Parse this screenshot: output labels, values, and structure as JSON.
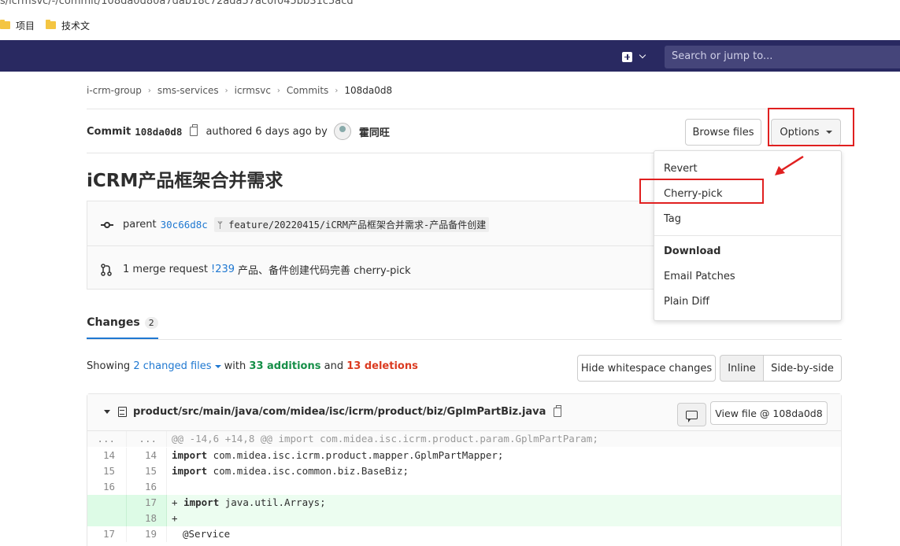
{
  "browser": {
    "url": "s/icrmsvc/-/commit/108da0d80a7dab18c72ada57ac0f045bb31c5acd",
    "bookmarks": [
      {
        "label": "项目",
        "icon": "folder-icon"
      },
      {
        "label": "技术文",
        "icon": "folder-icon"
      }
    ]
  },
  "navbar": {
    "search_placeholder": "Search or jump to...",
    "new_icon": "plus-square-icon",
    "bg_color": "#292961"
  },
  "breadcrumb": [
    "i-crm-group",
    "sms-services",
    "icrmsvc",
    "Commits",
    "108da0d8"
  ],
  "commit": {
    "label": "Commit",
    "sha": "108da0d8",
    "authored": "authored 6 days ago by",
    "author": "霍同旺",
    "browse_files": "Browse files",
    "options": "Options",
    "title": "iCRM产品框架合并需求",
    "parent_label": "parent",
    "parent_sha": "30c66d8c",
    "branch": "feature/20220415/iCRM产品框架合并需求-产品备件创建",
    "mr_prefix": "1 merge request",
    "mr_ref": "!239",
    "mr_title": "产品、备件创建代码完善 cherry-pick"
  },
  "options_menu": {
    "items": [
      "Revert",
      "Cherry-pick",
      "Tag"
    ],
    "download_header": "Download",
    "download_items": [
      "Email Patches",
      "Plain Diff"
    ]
  },
  "changes": {
    "tab_label": "Changes",
    "count": "2",
    "showing": "Showing",
    "files_link": "2 changed files",
    "with": "with",
    "additions": "33 additions",
    "and": "and",
    "deletions": "13 deletions",
    "hide_whitespace": "Hide whitespace changes",
    "inline": "Inline",
    "side_by_side": "Side-by-side"
  },
  "file": {
    "path": "product/src/main/java/com/midea/isc/icrm/product/biz/GplmPartBiz.java",
    "view_file": "View file @ 108da0d8"
  },
  "diff_lines": [
    {
      "old": "...",
      "new": "...",
      "sign": "",
      "code": "@@ -14,6 +14,8 @@ import com.midea.isc.icrm.product.param.GplmPartParam;",
      "type": "hunk"
    },
    {
      "old": "14",
      "new": "14",
      "sign": "",
      "kw": "import",
      "code": " com.midea.isc.icrm.product.mapper.GplmPartMapper;",
      "type": "ctx"
    },
    {
      "old": "15",
      "new": "15",
      "sign": "",
      "kw": "import",
      "code": " com.midea.isc.common.biz.BaseBiz;",
      "type": "ctx"
    },
    {
      "old": "16",
      "new": "16",
      "sign": "",
      "code": "",
      "type": "ctx"
    },
    {
      "old": "",
      "new": "17",
      "sign": "+",
      "kw": "import",
      "code": " java.util.Arrays;",
      "type": "new"
    },
    {
      "old": "",
      "new": "18",
      "sign": "+",
      "code": "",
      "type": "new"
    },
    {
      "old": "17",
      "new": "19",
      "sign": "",
      "code": "@Service",
      "type": "ctx"
    }
  ],
  "colors": {
    "accent": "#1f78d1",
    "addition": "#168f48",
    "deletion": "#db3b21",
    "annotation_red": "#e02020"
  }
}
